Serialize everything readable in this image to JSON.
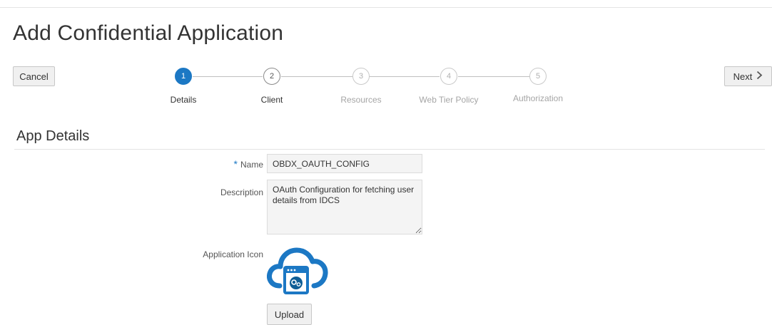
{
  "page": {
    "title": "Add Confidential Application"
  },
  "toolbar": {
    "cancel_label": "Cancel",
    "next_label": "Next"
  },
  "train": {
    "steps": [
      {
        "number": "1",
        "label": "Details",
        "state": "active"
      },
      {
        "number": "2",
        "label": "Client",
        "state": "visited"
      },
      {
        "number": "3",
        "label": "Resources",
        "state": "todo"
      },
      {
        "number": "4",
        "label": "Web Tier Policy",
        "state": "todo"
      },
      {
        "number": "5",
        "label": "Authorization",
        "state": "todo"
      }
    ]
  },
  "section": {
    "title": "App Details"
  },
  "form": {
    "name_required_marker": "*",
    "name_label": "Name",
    "name_value": "OBDX_OAUTH_CONFIG",
    "description_label": "Description",
    "description_value": "OAuth Configuration for fetching user details from IDCS",
    "icon_label": "Application Icon",
    "upload_label": "Upload"
  },
  "colors": {
    "accent": "#1c78c4",
    "icon_gear_bg": "#0f5e96"
  },
  "icons": {
    "next": "chevron-right-icon",
    "application": "cloud-app-icon"
  }
}
